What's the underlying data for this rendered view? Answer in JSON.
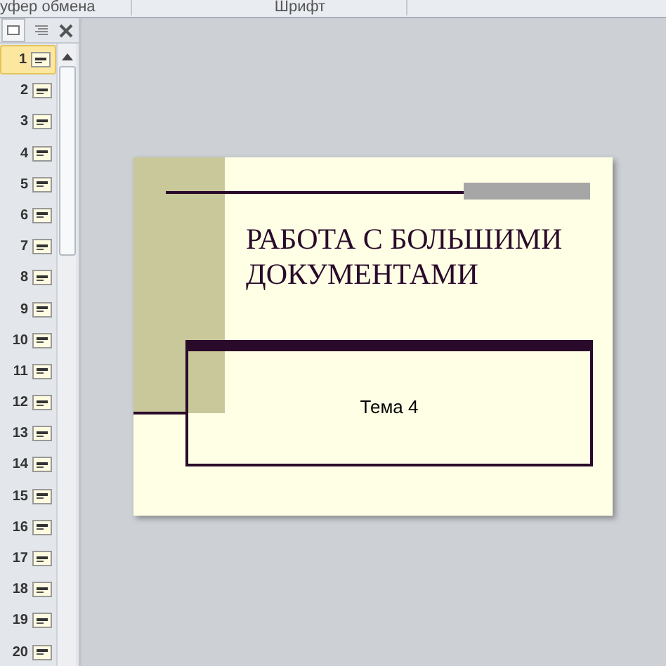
{
  "ribbon": {
    "groups": [
      "уфер обмена",
      "Шрифт"
    ]
  },
  "slides_panel": {
    "thumbnails": [
      {
        "number": "1",
        "selected": true
      },
      {
        "number": "2",
        "selected": false
      },
      {
        "number": "3",
        "selected": false
      },
      {
        "number": "4",
        "selected": false
      },
      {
        "number": "5",
        "selected": false
      },
      {
        "number": "6",
        "selected": false
      },
      {
        "number": "7",
        "selected": false
      },
      {
        "number": "8",
        "selected": false
      },
      {
        "number": "9",
        "selected": false
      },
      {
        "number": "10",
        "selected": false
      },
      {
        "number": "11",
        "selected": false
      },
      {
        "number": "12",
        "selected": false
      },
      {
        "number": "13",
        "selected": false
      },
      {
        "number": "14",
        "selected": false
      },
      {
        "number": "15",
        "selected": false
      },
      {
        "number": "16",
        "selected": false
      },
      {
        "number": "17",
        "selected": false
      },
      {
        "number": "18",
        "selected": false
      },
      {
        "number": "19",
        "selected": false
      },
      {
        "number": "20",
        "selected": false
      }
    ]
  },
  "slide": {
    "title": "РАБОТА С БОЛЬШИМИ ДОКУМЕНТАМИ",
    "subtitle": "Тема 4"
  }
}
